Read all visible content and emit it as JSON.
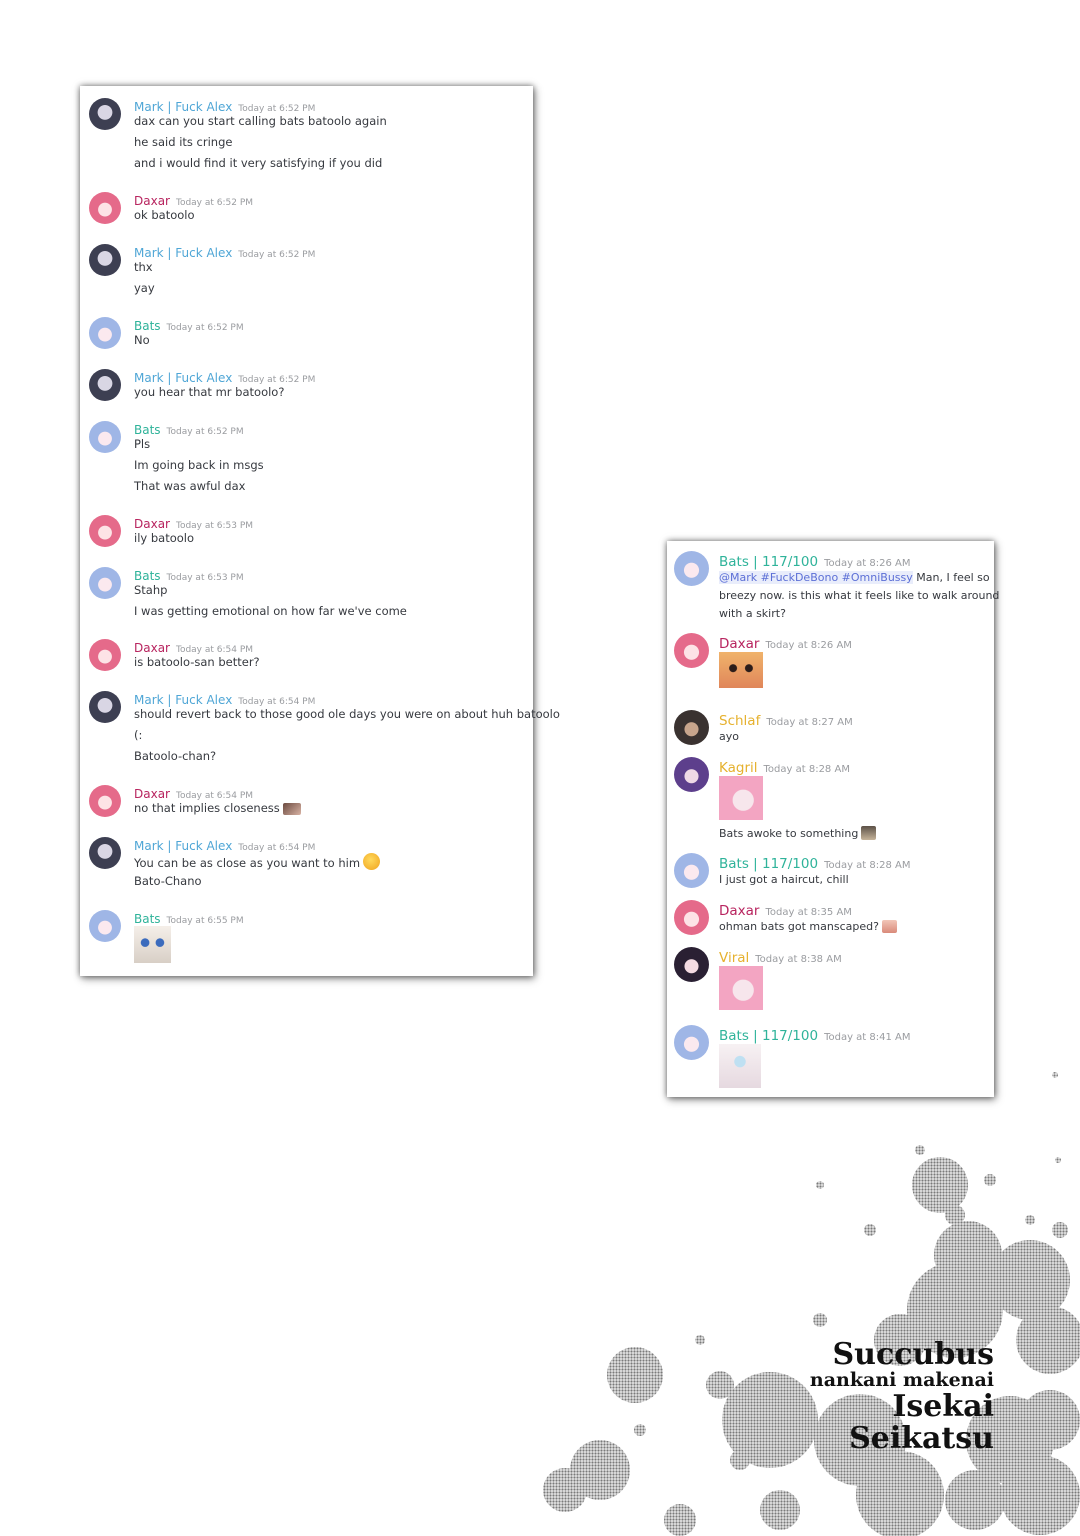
{
  "colors": {
    "mark": "#4fa6d6",
    "daxar": "#b8245f",
    "bats": "#2fb39a",
    "schlaf": "#e6b12e",
    "kagril": "#e6b12e",
    "viral": "#e6b12e",
    "bats_right": "#2fb39a",
    "daxar_right": "#b8245f"
  },
  "left_chat": {
    "messages": [
      {
        "user": "Mark | Fuck Alex",
        "time": "Today at 6:52 PM",
        "lines": [
          "dax can you start calling bats batoolo again",
          "he said its cringe",
          "and i would find it very satisfying if you did"
        ]
      },
      {
        "user": "Daxar",
        "time": "Today at 6:52 PM",
        "lines": [
          "ok batoolo"
        ]
      },
      {
        "user": "Mark | Fuck Alex",
        "time": "Today at 6:52 PM",
        "lines": [
          "thx",
          "yay"
        ]
      },
      {
        "user": "Bats",
        "time": "Today at 6:52 PM",
        "lines": [
          "No"
        ]
      },
      {
        "user": "Mark | Fuck Alex",
        "time": "Today at 6:52 PM",
        "lines": [
          "you hear that mr batoolo?"
        ]
      },
      {
        "user": "Bats",
        "time": "Today at 6:52 PM",
        "lines": [
          "Pls",
          "Im going back in msgs",
          "That was awful dax"
        ]
      },
      {
        "user": "Daxar",
        "time": "Today at 6:53 PM",
        "lines": [
          "ily batoolo"
        ]
      },
      {
        "user": "Bats",
        "time": "Today at 6:53 PM",
        "lines": [
          "Stahp",
          "I was getting emotional on how far we've come"
        ]
      },
      {
        "user": "Daxar",
        "time": "Today at 6:54 PM",
        "lines": [
          "is batoolo-san better?"
        ]
      },
      {
        "user": "Mark | Fuck Alex",
        "time": "Today at 6:54 PM",
        "lines": [
          "should revert back to those good ole days you were on about huh batoolo",
          "(:",
          "Batoolo-chan?"
        ]
      },
      {
        "user": "Daxar",
        "time": "Today at 6:54 PM",
        "lines": [
          "no that implies closeness"
        ]
      },
      {
        "user": "Mark | Fuck Alex",
        "time": "Today at 6:54 PM",
        "lines": [
          "You can be as close as you want to him",
          "Bato-Chano"
        ]
      },
      {
        "user": "Bats",
        "time": "Today at 6:55 PM",
        "lines": []
      }
    ]
  },
  "right_chat": {
    "messages": [
      {
        "user": "Bats | 117/100",
        "time": "Today at 8:26 AM",
        "mention": "@Mark #FuckDeBono #OmniBussy",
        "lines": [
          "Man, I feel so",
          "breezy now. is this what it feels like to walk around",
          "with a skirt?"
        ]
      },
      {
        "user": "Daxar",
        "time": "Today at 8:26 AM",
        "lines": []
      },
      {
        "user": "Schlaf",
        "time": "Today at 8:27 AM",
        "lines": [
          "ayo"
        ]
      },
      {
        "user": "Kagril",
        "time": "Today at 8:28 AM",
        "lines": [
          "Bats awoke to something"
        ]
      },
      {
        "user": "Bats | 117/100",
        "time": "Today at 8:28 AM",
        "lines": [
          "I just got a haircut, chill"
        ]
      },
      {
        "user": "Daxar",
        "time": "Today at 8:35 AM",
        "lines": [
          "ohman bats got manscaped?"
        ]
      },
      {
        "user": "Viral",
        "time": "Today at 8:38 AM",
        "lines": []
      },
      {
        "user": "Bats | 117/100",
        "time": "Today at 8:41 AM",
        "lines": []
      }
    ]
  },
  "title": {
    "line1": "Succubus",
    "line2": "nankani makenai",
    "line3": "Isekai",
    "line4": "Seikatsu"
  }
}
